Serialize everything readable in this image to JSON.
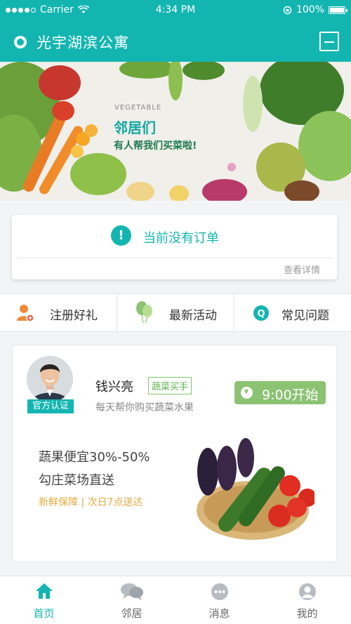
{
  "status": {
    "carrier": "Carrier",
    "time": "4:34 PM",
    "battery": "100%"
  },
  "header": {
    "title": "光宇湖滨公寓"
  },
  "banner": {
    "en": "VEGETABLE",
    "title": "邻居们",
    "subtitle": "有人帮我们买菜啦!"
  },
  "order": {
    "message": "当前没有订单",
    "detail_link": "查看详情"
  },
  "quick_menu": [
    {
      "label": "注册好礼",
      "icon": "gift-user-icon"
    },
    {
      "label": "最新活动",
      "icon": "balloon-icon"
    },
    {
      "label": "常见问题",
      "icon": "question-icon"
    }
  ],
  "buyer": {
    "name": "钱兴亮",
    "tag": "蔬菜买手",
    "cert": "官方认证",
    "desc": "每天帮你购买蔬菜水果",
    "start_time": "9:00开始",
    "feature1": "蔬果便宜30%-50%",
    "feature2": "勾庄菜场直送",
    "feature3": "新鲜保障 | 次日7点送达"
  },
  "tabs": [
    {
      "label": "首页",
      "icon": "home-icon",
      "active": true
    },
    {
      "label": "邻居",
      "icon": "chat-icon",
      "active": false
    },
    {
      "label": "消息",
      "icon": "message-icon",
      "active": false
    },
    {
      "label": "我的",
      "icon": "profile-icon",
      "active": false
    }
  ],
  "colors": {
    "primary": "#13b5b1",
    "green": "#8bc373",
    "orange": "#e6a93d"
  }
}
